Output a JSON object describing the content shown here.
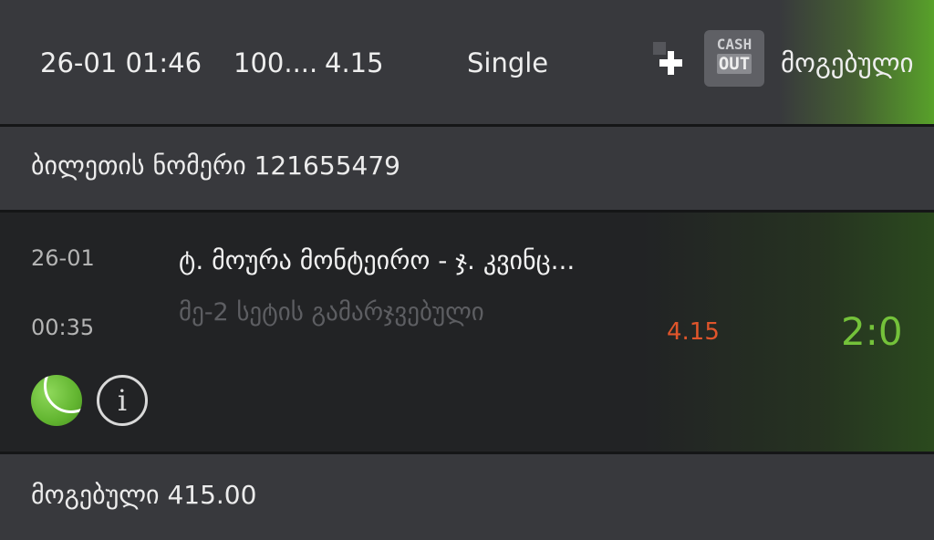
{
  "header": {
    "datetime": "26-01 01:46",
    "stake": "100....",
    "odds": "4.15",
    "bet_type": "Single",
    "cashout_line1": "CASH",
    "cashout_line2": "OUT",
    "status": "მოგებული"
  },
  "ticket": {
    "label": "ბილეთის ნომერი 121655479"
  },
  "event": {
    "date": "26-01",
    "time": "00:35",
    "match": "ტ. მოურა მონტეირო - ჯ. კვინც...",
    "market": "მე-2 სეტის გამარჯვებული",
    "odds": "4.15",
    "score": "2:0",
    "sport_icon": "tennis-ball-icon",
    "info_icon": "info-icon"
  },
  "footer": {
    "winnings": "მოგებული 415.00"
  },
  "colors": {
    "win_green": "#74c23a",
    "odds_orange": "#e0552b",
    "panel": "#38393d",
    "event_bg": "#222325"
  }
}
